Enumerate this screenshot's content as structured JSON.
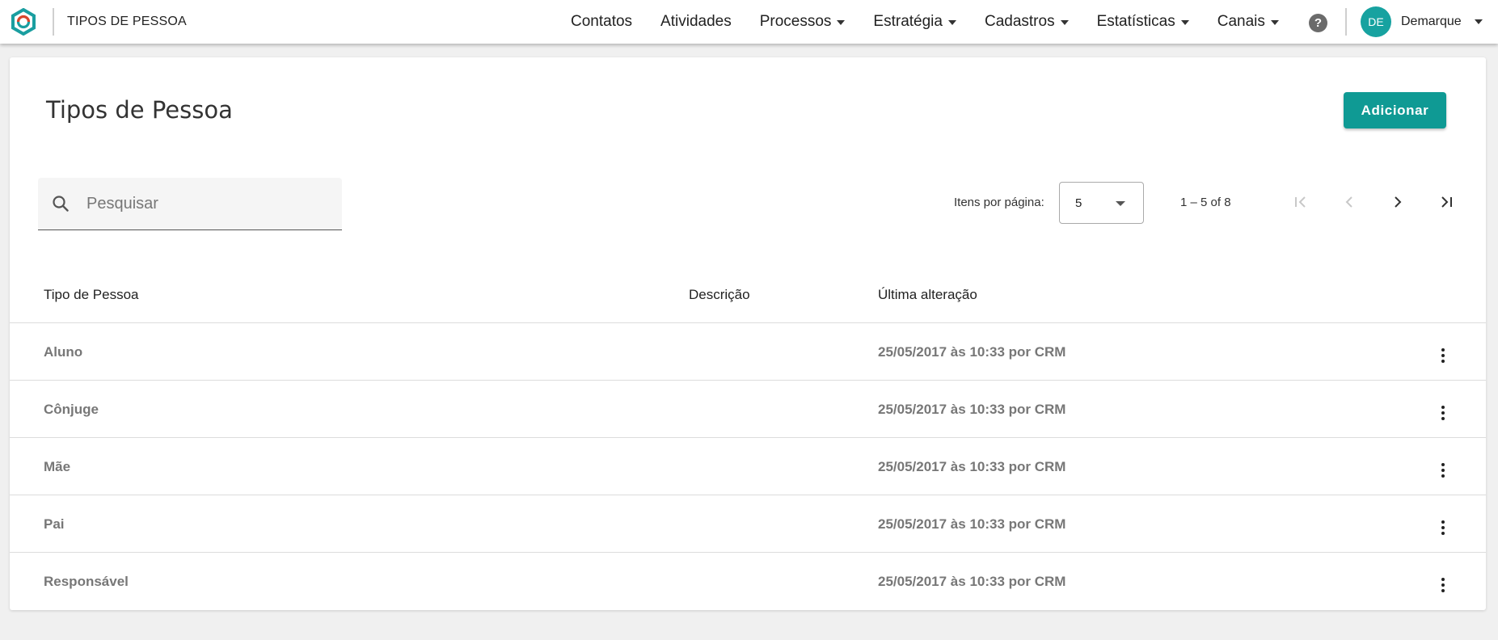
{
  "header": {
    "app_title": "TIPOS DE PESSOA",
    "nav": [
      {
        "label": "Contatos",
        "dropdown": false
      },
      {
        "label": "Atividades",
        "dropdown": false
      },
      {
        "label": "Processos",
        "dropdown": true
      },
      {
        "label": "Estratégia",
        "dropdown": true
      },
      {
        "label": "Cadastros",
        "dropdown": true
      },
      {
        "label": "Estatísticas",
        "dropdown": true
      },
      {
        "label": "Canais",
        "dropdown": true
      }
    ],
    "help_label": "?",
    "avatar_initials": "DE",
    "user_name": "Demarque"
  },
  "page": {
    "title": "Tipos de Pessoa",
    "add_button": "Adicionar"
  },
  "search": {
    "placeholder": "Pesquisar",
    "value": ""
  },
  "paginator": {
    "items_per_page_label": "Itens por página:",
    "page_size": "5",
    "range_label": "1 – 5 of 8"
  },
  "table": {
    "columns": [
      "Tipo de Pessoa",
      "Descrição",
      "Última alteração"
    ],
    "rows": [
      {
        "tipo": "Aluno",
        "descricao": "",
        "alteracao": "25/05/2017 às 10:33 por CRM"
      },
      {
        "tipo": "Cônjuge",
        "descricao": "",
        "alteracao": "25/05/2017 às 10:33 por CRM"
      },
      {
        "tipo": "Mãe",
        "descricao": "",
        "alteracao": "25/05/2017 às 10:33 por CRM"
      },
      {
        "tipo": "Pai",
        "descricao": "",
        "alteracao": "25/05/2017 às 10:33 por CRM"
      },
      {
        "tipo": "Responsável",
        "descricao": "",
        "alteracao": "25/05/2017 às 10:33 por CRM"
      }
    ]
  },
  "colors": {
    "accent": "#0f9a94",
    "avatar": "#17a2a0",
    "logo_teal": "#1a9ea0",
    "logo_red": "#d8452b"
  }
}
